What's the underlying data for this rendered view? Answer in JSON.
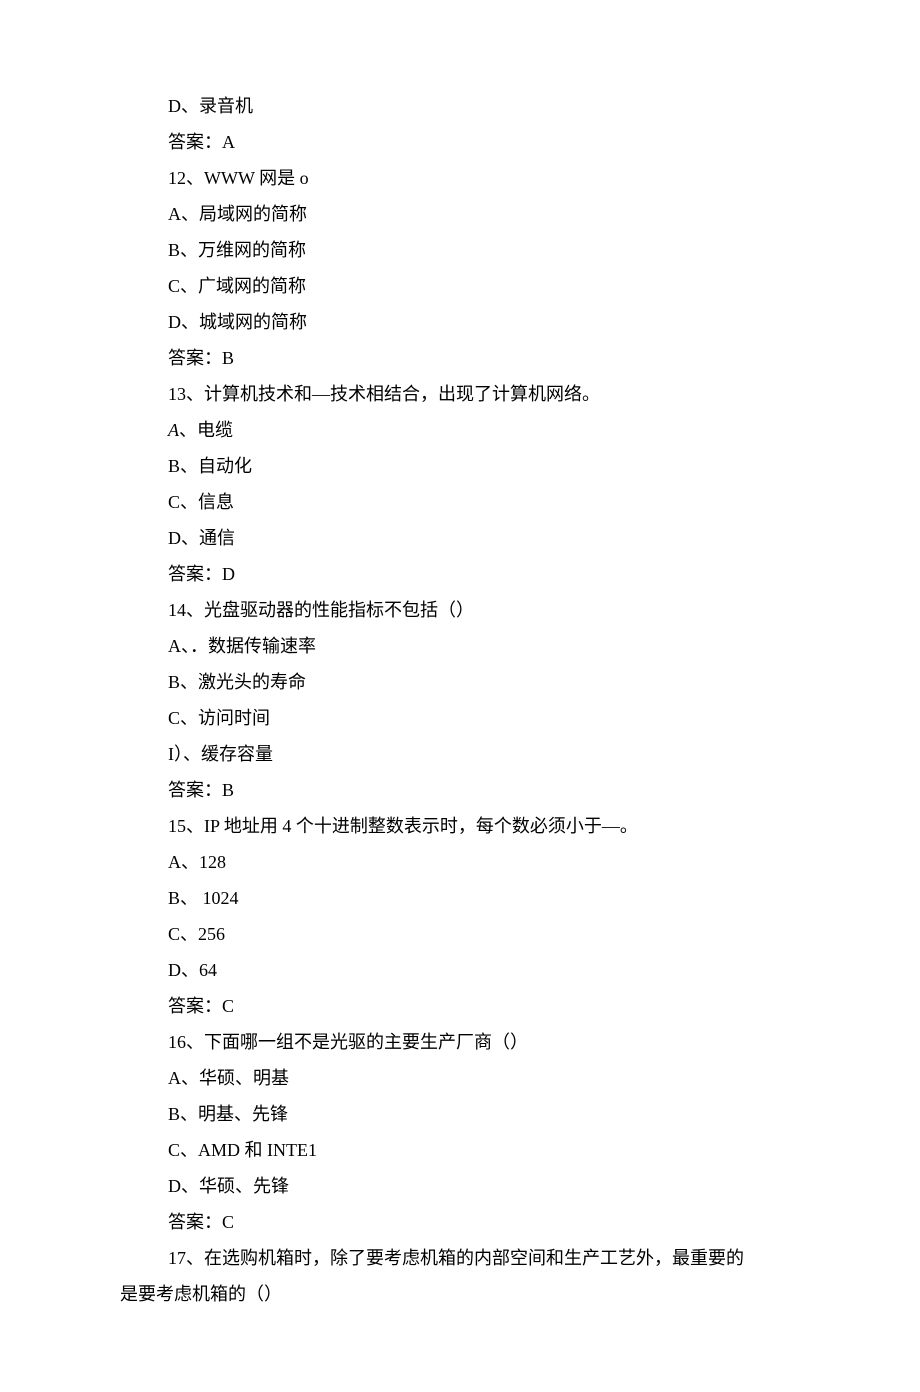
{
  "lines": [
    {
      "text": "D、录音机"
    },
    {
      "text": "答案：A"
    },
    {
      "text": "12、WWW 网是 o"
    },
    {
      "text": "A、局域网的简称"
    },
    {
      "text": "B、万维网的简称"
    },
    {
      "text": "C、广域网的简称"
    },
    {
      "text": "D、城域网的简称"
    },
    {
      "text": "答案：B"
    },
    {
      "text": "13、计算机技术和—技术相结合，出现了计算机网络。"
    },
    {
      "prefix_italic": "A",
      "rest": "、电缆"
    },
    {
      "text": "B、自动化"
    },
    {
      "text": "C、信息"
    },
    {
      "text": "D、通信"
    },
    {
      "text": "答案：D"
    },
    {
      "text": "14、光盘驱动器的性能指标不包括（）"
    },
    {
      "text": "A、．数据传输速率"
    },
    {
      "text": "B、激光头的寿命"
    },
    {
      "text": "C、访问时间"
    },
    {
      "text": "I）、缓存容量"
    },
    {
      "text": "答案：B"
    },
    {
      "text": "15、IP 地址用 4 个十进制整数表示时，每个数必须小于—。"
    },
    {
      "text": "A、128"
    },
    {
      "text": "B、 1024"
    },
    {
      "text": "C、256"
    },
    {
      "text": "D、64"
    },
    {
      "text": "答案：C"
    },
    {
      "text": "16、下面哪一组不是光驱的主要生产厂商（）"
    },
    {
      "text": "A、华硕、明基"
    },
    {
      "text": "B、明基、先锋"
    },
    {
      "text": "C、AMD 和 INTE1"
    },
    {
      "text": "D、华硕、先锋"
    },
    {
      "text": "答案：C"
    }
  ],
  "para": {
    "l1": "17、在选购机箱时，除了要考虑机箱的内部空间和生产工艺外，最重要的",
    "l2": "是要考虑机箱的（）"
  }
}
